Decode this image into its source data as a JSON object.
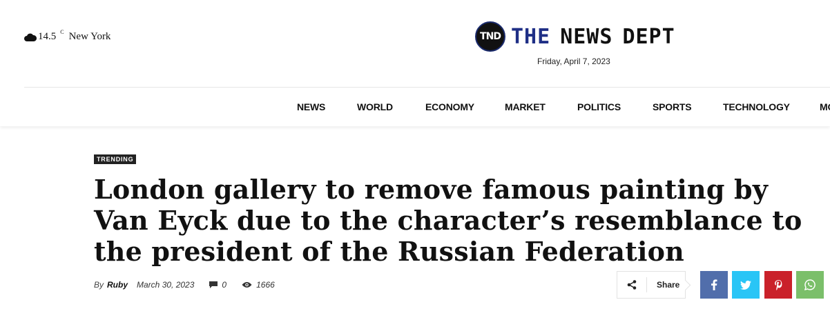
{
  "weather": {
    "temperature": "14.5",
    "unit": "C",
    "city": "New York",
    "icon": "cloud-icon"
  },
  "brand": {
    "badge": "TND",
    "word1": "THE",
    "word2": "NEWS",
    "word3": "DEPT"
  },
  "header": {
    "date": "Friday, April 7, 2023"
  },
  "nav": {
    "items": [
      "NEWS",
      "WORLD",
      "ECONOMY",
      "MARKET",
      "POLITICS",
      "SPORTS",
      "TECHNOLOGY",
      "MORE"
    ]
  },
  "article": {
    "category": "TRENDING",
    "title": "London gallery to remove famous painting by Van Eyck due to the character’s resemblance to the president of the Russian Federation",
    "by_label": "By",
    "author": "Ruby",
    "date": "March 30, 2023",
    "comments": "0",
    "views": "1666"
  },
  "share": {
    "label": "Share",
    "buttons": [
      {
        "network": "facebook",
        "icon": "facebook-icon",
        "color": "#516eab"
      },
      {
        "network": "twitter",
        "icon": "twitter-icon",
        "color": "#29c5f6"
      },
      {
        "network": "pinterest",
        "icon": "pinterest-icon",
        "color": "#ca212a"
      },
      {
        "network": "whatsapp",
        "icon": "whatsapp-icon",
        "color": "#7bbf6a"
      }
    ]
  },
  "colors": {
    "brand_blue": "#1f2f86",
    "text": "#111111"
  }
}
